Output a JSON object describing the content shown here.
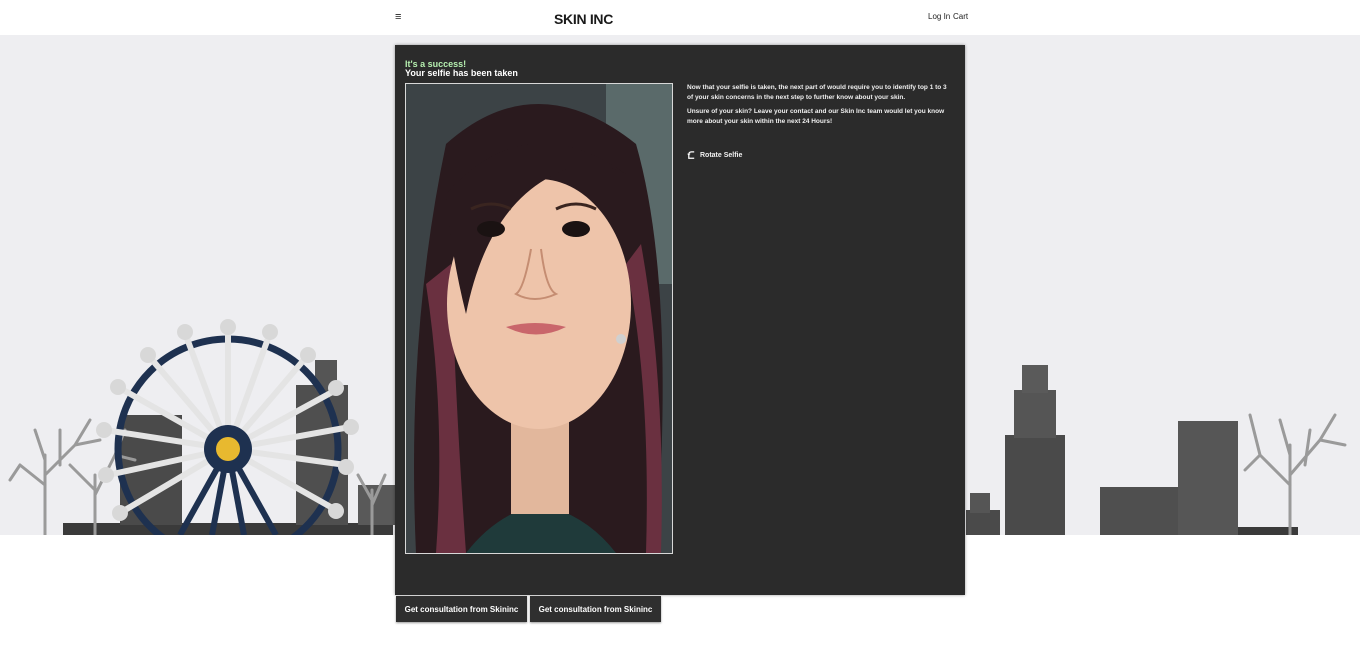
{
  "header": {
    "menu_icon": "hamburger-menu-icon",
    "logo": "SKIN INC",
    "login": "Log In",
    "cart": "Cart"
  },
  "panel": {
    "success_text": "It's a success!",
    "subtitle": "Your selfie has been taken",
    "paragraph1": "Now that your selfie is taken, the next part of would require you to identify top 1 to 3 of your skin concerns in the next step to further know about your skin.",
    "paragraph2": "Unsure of your skin? Leave your contact and our Skin Inc team would let you know more about your skin within the next 24 Hours!",
    "rotate_label": "Rotate Selfie",
    "rotate_icon": "rotate-icon"
  },
  "buttons": [
    {
      "label": "Get consultation from Skininc"
    },
    {
      "label": "Get consultation from Skininc"
    }
  ],
  "colors": {
    "panel_bg": "#2b2b2b",
    "success_text": "#b6f0b0",
    "hero_bg": "#eeeef1"
  }
}
